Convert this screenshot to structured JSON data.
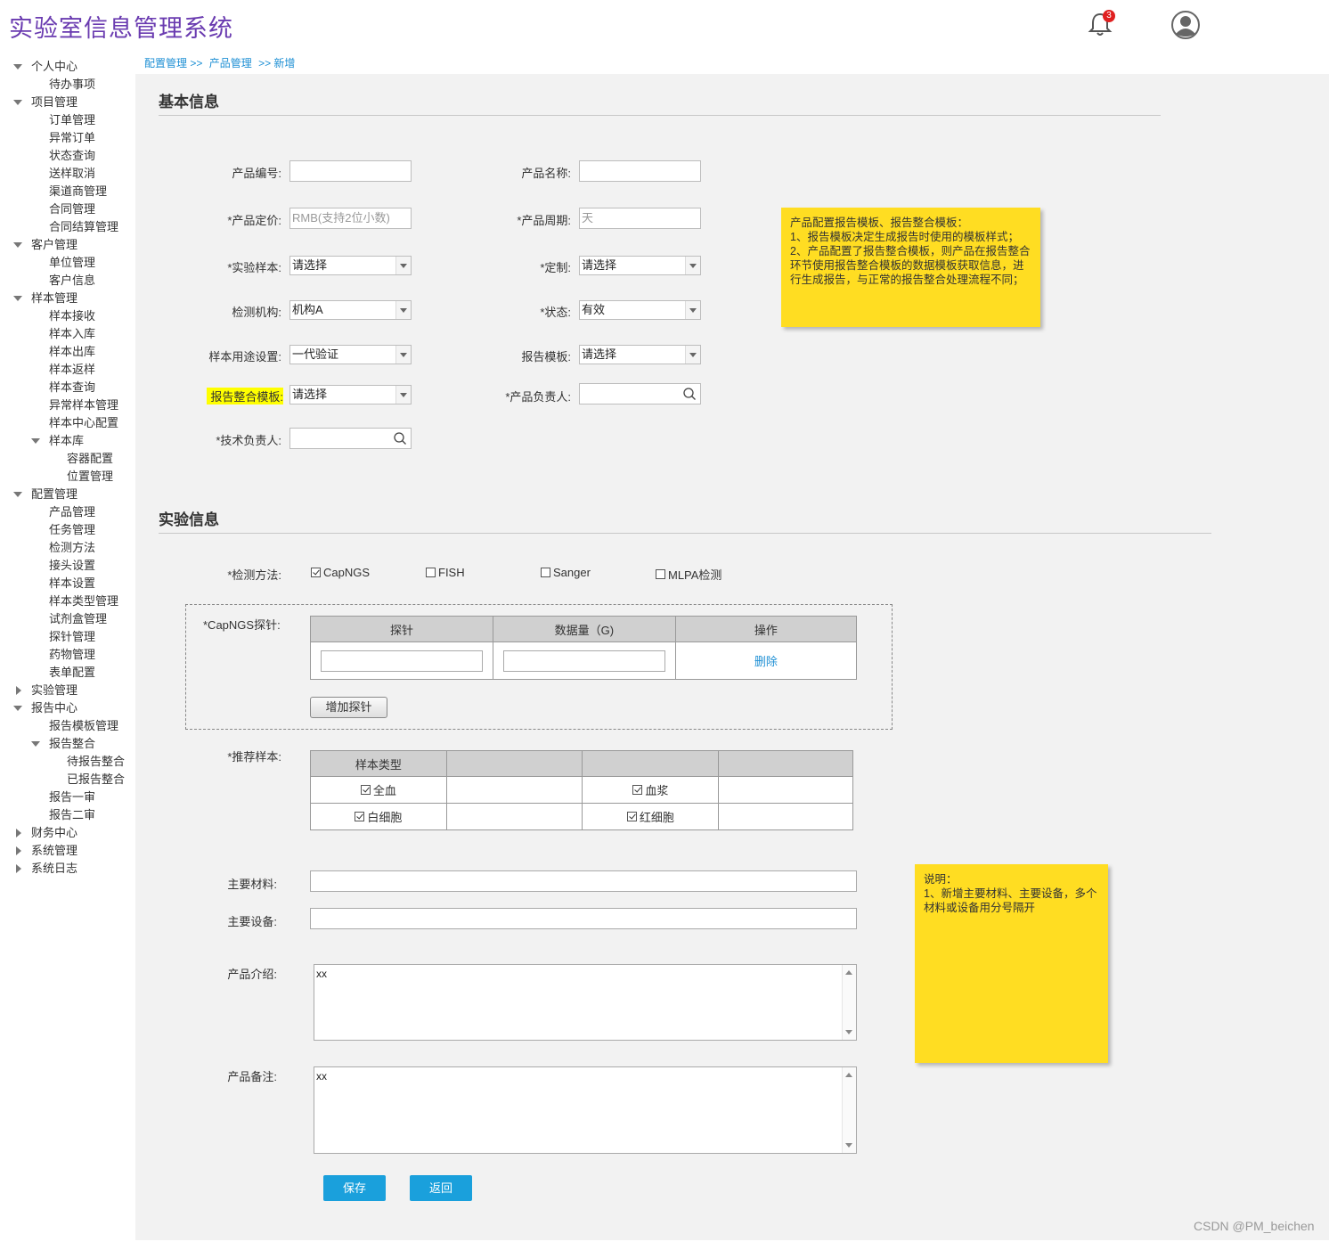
{
  "app": {
    "title": "实验室信息管理系统",
    "notification_count": "3"
  },
  "breadcrumb": [
    "配置管理 >>",
    "产品管理",
    ">> 新增"
  ],
  "sidebar": [
    {
      "label": "个人中心",
      "level": 0,
      "state": "open"
    },
    {
      "label": "待办事项",
      "level": 1
    },
    {
      "label": "项目管理",
      "level": 0,
      "state": "open"
    },
    {
      "label": "订单管理",
      "level": 1
    },
    {
      "label": "异常订单",
      "level": 1
    },
    {
      "label": "状态查询",
      "level": 1
    },
    {
      "label": "送样取消",
      "level": 1
    },
    {
      "label": "渠道商管理",
      "level": 1
    },
    {
      "label": "合同管理",
      "level": 1
    },
    {
      "label": "合同结算管理",
      "level": 1
    },
    {
      "label": "客户管理",
      "level": 0,
      "state": "open"
    },
    {
      "label": "单位管理",
      "level": 1
    },
    {
      "label": "客户信息",
      "level": 1
    },
    {
      "label": "样本管理",
      "level": 0,
      "state": "open"
    },
    {
      "label": "样本接收",
      "level": 1
    },
    {
      "label": "样本入库",
      "level": 1
    },
    {
      "label": "样本出库",
      "level": 1
    },
    {
      "label": "样本返样",
      "level": 1
    },
    {
      "label": "样本查询",
      "level": 1
    },
    {
      "label": "异常样本管理",
      "level": 1
    },
    {
      "label": "样本中心配置",
      "level": 1
    },
    {
      "label": "样本库",
      "level": 1,
      "state": "open"
    },
    {
      "label": "容器配置",
      "level": 2
    },
    {
      "label": "位置管理",
      "level": 2
    },
    {
      "label": "配置管理",
      "level": 0,
      "state": "open"
    },
    {
      "label": "产品管理",
      "level": 1
    },
    {
      "label": "任务管理",
      "level": 1
    },
    {
      "label": "检测方法",
      "level": 1
    },
    {
      "label": "接头设置",
      "level": 1
    },
    {
      "label": "样本设置",
      "level": 1
    },
    {
      "label": "样本类型管理",
      "level": 1
    },
    {
      "label": "试剂盒管理",
      "level": 1
    },
    {
      "label": "探针管理",
      "level": 1
    },
    {
      "label": "药物管理",
      "level": 1
    },
    {
      "label": "表单配置",
      "level": 1
    },
    {
      "label": "实验管理",
      "level": 0,
      "state": "closed"
    },
    {
      "label": "报告中心",
      "level": 0,
      "state": "open"
    },
    {
      "label": "报告模板管理",
      "level": 1
    },
    {
      "label": "报告整合",
      "level": 1,
      "state": "open"
    },
    {
      "label": "待报告整合",
      "level": 2
    },
    {
      "label": "已报告整合",
      "level": 2
    },
    {
      "label": "报告一审",
      "level": 1
    },
    {
      "label": "报告二审",
      "level": 1
    },
    {
      "label": "财务中心",
      "level": 0,
      "state": "closed"
    },
    {
      "label": "系统管理",
      "level": 0,
      "state": "closed"
    },
    {
      "label": "系统日志",
      "level": 0,
      "state": "closed"
    }
  ],
  "basic": {
    "title": "基本信息",
    "product_code_label": "产品编号:",
    "product_name_label": "产品名称:",
    "price_label": "*产品定价:",
    "price_placeholder": "RMB(支持2位小数)",
    "cycle_label": "*产品周期:",
    "cycle_placeholder": "天",
    "sample_label": "*实验样本:",
    "sample_value": "请选择",
    "custom_label": "*定制:",
    "custom_value": "请选择",
    "org_label": "检测机构:",
    "org_value": "机构A",
    "status_label": "*状态:",
    "status_value": "有效",
    "usage_label": "样本用途设置:",
    "usage_value": "一代验证",
    "report_tpl_label": "报告模板:",
    "report_tpl_value": "请选择",
    "merge_tpl_label": "报告整合模板:",
    "merge_tpl_value": "请选择",
    "owner_label": "*产品负责人:",
    "tech_owner_label": "*技术负责人:"
  },
  "note1": "产品配置报告模板、报告整合模板：\n1、报告模板决定生成报告时使用的模板样式；\n2、产品配置了报告整合模板，则产品在报告整合环节使用报告整合模板的数据模板获取信息，进行生成报告，与正常的报告整合处理流程不同；",
  "experiment": {
    "title": "实验信息",
    "method_label": "*检测方法:",
    "methods": [
      {
        "label": "CapNGS",
        "checked": true
      },
      {
        "label": "FISH",
        "checked": false
      },
      {
        "label": "Sanger",
        "checked": false
      },
      {
        "label": "MLPA检测",
        "checked": false
      }
    ],
    "probe_label": "*CapNGS探针:",
    "probe_headers": [
      "探针",
      "数据量（G)",
      "操作"
    ],
    "delete_label": "删除",
    "add_probe_label": "增加探针",
    "rec_sample_label": "*推荐样本:",
    "sample_type_header": "样本类型",
    "samples": [
      [
        {
          "label": "全血",
          "checked": true
        },
        {
          "label": "血浆",
          "checked": true
        }
      ],
      [
        {
          "label": "白细胞",
          "checked": true
        },
        {
          "label": "红细胞",
          "checked": true
        }
      ]
    ],
    "material_label": "主要材料:",
    "equipment_label": "主要设备:",
    "intro_label": "产品介绍:",
    "intro_value": "xx",
    "remark_label": "产品备注:",
    "remark_value": "xx"
  },
  "note2": "说明：\n1、新增主要材料、主要设备，多个材料或设备用分号隔开",
  "buttons": {
    "save": "保存",
    "back": "返回"
  },
  "watermark": "CSDN @PM_beichen",
  "colors": {
    "accent": "#1aa0dc",
    "title": "#6a3bb0",
    "note": "#ffdd22",
    "highlight": "#ffff00"
  }
}
